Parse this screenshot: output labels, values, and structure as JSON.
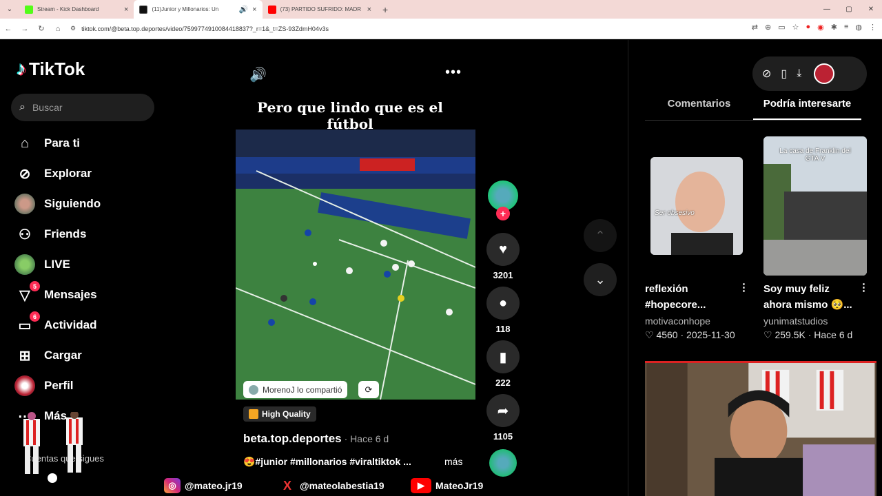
{
  "browser": {
    "tabs": [
      {
        "title": "Stream - Kick Dashboard",
        "fav_color": "#53fc18"
      },
      {
        "title": "(11)Junior y Millonarios: Un",
        "fav_color": "#111111",
        "active": true
      },
      {
        "title": "(73) PARTIDO SUFRIDO: MADR",
        "fav_color": "#ff0000"
      }
    ],
    "url": "tiktok.com/@beta.top.deportes/video/7599774910084418837?_r=1&_t=ZS-93ZdmH04v3s"
  },
  "sidebar": {
    "logo": "TikTok",
    "search_placeholder": "Buscar",
    "items": [
      {
        "label": "Para ti",
        "icon": "home-icon"
      },
      {
        "label": "Explorar",
        "icon": "compass-icon"
      },
      {
        "label": "Siguiendo",
        "icon": "avatar"
      },
      {
        "label": "Friends",
        "icon": "friends-icon"
      },
      {
        "label": "LIVE",
        "icon": "live-avatar"
      },
      {
        "label": "Mensajes",
        "icon": "messages-icon",
        "badge": "5"
      },
      {
        "label": "Actividad",
        "icon": "activity-icon",
        "badge": "6"
      },
      {
        "label": "Cargar",
        "icon": "upload-icon"
      },
      {
        "label": "Perfil",
        "icon": "profile-avatar"
      },
      {
        "label": "Más",
        "icon": "more-icon"
      }
    ],
    "following_label": "Cuentas que sigues"
  },
  "video": {
    "title": "Pero que lindo que es el fútbol",
    "shared_by": "MorenoJ lo compartió",
    "quality": "High Quality",
    "author": "beta.top.deportes",
    "time": "· Hace 6 d",
    "description": "😍#junior #millonarios #viraltiktok ...",
    "more": "más"
  },
  "actions": {
    "likes": "3201",
    "comments": "118",
    "saves": "222",
    "shares": "1105"
  },
  "right_panel": {
    "tabs": [
      "Comentarios",
      "Podría interesarte"
    ],
    "cards": [
      {
        "thumb_text": "Ser obsesivo",
        "title": "reflexión #hopecore...",
        "author": "motivaconhope",
        "likes": "♡ 4560",
        "date": "2025-11-30"
      },
      {
        "thumb_text": "La casa de Franklin del GTA V",
        "title": "Soy muy feliz ahora mismo 🥺...",
        "author": "yunimatstudios",
        "likes": "♡ 259.5K",
        "date": "Hace 6 d"
      }
    ]
  },
  "overlay": {
    "instagram": "@mateo.jr19",
    "x": "@mateolabestia19",
    "youtube": "MateoJr19"
  }
}
